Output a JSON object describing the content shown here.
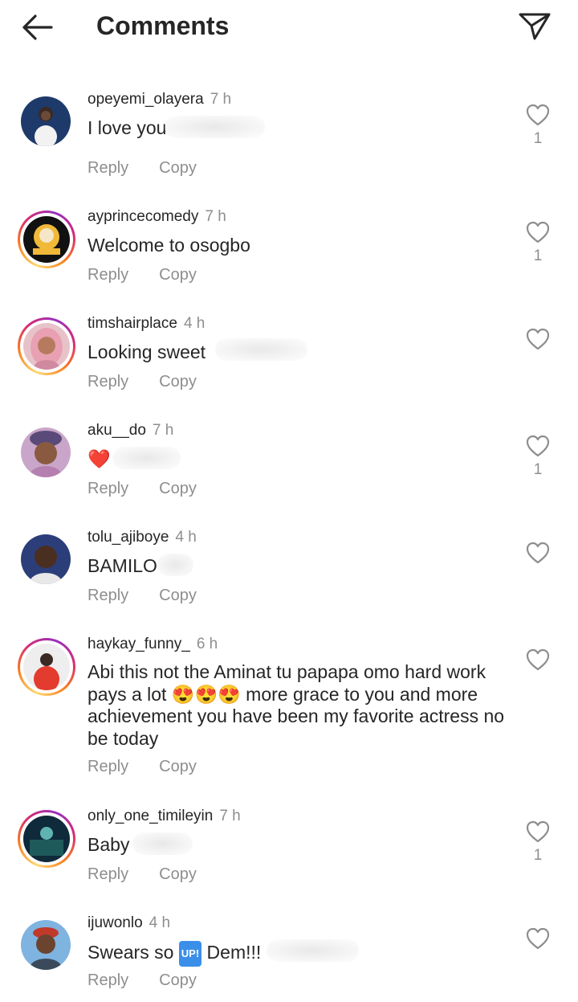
{
  "header": {
    "title": "Comments",
    "back_icon": "arrow-left-icon",
    "share_icon": "send-icon"
  },
  "actions": {
    "reply_label": "Reply",
    "copy_label": "Copy"
  },
  "comments": [
    {
      "username": "opeyemi_olayera",
      "time": "7 h",
      "text": "I love you",
      "likes": "1",
      "story_ring": false
    },
    {
      "username": "ayprincecomedy",
      "time": "7 h",
      "text": "Welcome to osogbo",
      "likes": "1",
      "story_ring": true
    },
    {
      "username": "timshairplace",
      "time": "4 h",
      "text": "Looking sweet",
      "likes": "",
      "story_ring": true
    },
    {
      "username": "aku__do",
      "time": "7 h",
      "text": "❤️",
      "likes": "1",
      "story_ring": false
    },
    {
      "username": "tolu_ajiboye",
      "time": "4 h",
      "text": "BAMILO",
      "likes": "",
      "story_ring": false
    },
    {
      "username": "haykay_funny_",
      "time": "6 h",
      "text_part1": "Abi this not the Aminat tu papapa omo hard work pays a lot",
      "text_emojis": "😍😍😍",
      "text_part2": "more grace to you and more achievement you have been my favorite actress no be today",
      "likes": "",
      "story_ring": true
    },
    {
      "username": "only_one_timileyin",
      "time": "7 h",
      "text": "Baby",
      "likes": "1",
      "story_ring": true
    },
    {
      "username": "ijuwonlo",
      "time": "4 h",
      "text_part1": "Swears so",
      "text_badge": "UP!",
      "text_part2": "Dem!!!",
      "likes": "",
      "story_ring": false
    }
  ],
  "colors": {
    "text": "#262626",
    "secondary": "#8e8e8e",
    "heart_emoji": "#e0245e"
  }
}
